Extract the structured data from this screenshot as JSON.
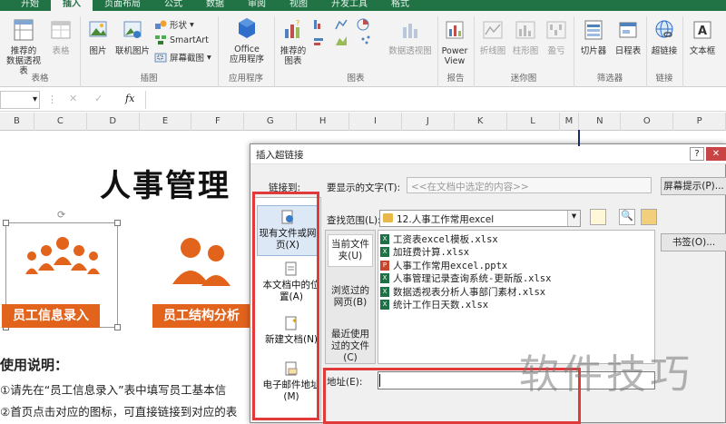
{
  "ribbon": {
    "tabs": [
      "开始",
      "插入",
      "页面布局",
      "公式",
      "数据",
      "审阅",
      "视图",
      "开发工具",
      "格式"
    ],
    "active_tab": "插入",
    "buttons": {
      "recommended_pivot": "推荐的\n数据透视表",
      "table": "表格",
      "picture": "图片",
      "online_picture": "联机图片",
      "shapes": "形状",
      "smartart": "SmartArt",
      "screenshot": "屏幕截图",
      "office_apps": "Office\n应用程序",
      "recommended_charts": "推荐的\n图表",
      "pivot_chart": "数据透视图",
      "power_view": "Power\nView",
      "line": "折线图",
      "column": "柱形图",
      "winloss": "盈亏",
      "slicer": "切片器",
      "timeline": "日程表",
      "hyperlink": "超链接",
      "textbox": "文本框"
    },
    "groups": {
      "tables": "表格",
      "illustrations": "插图",
      "apps": "应用程序",
      "charts": "图表",
      "reports": "报告",
      "sparklines": "迷你图",
      "filters": "筛选器",
      "links": "链接"
    }
  },
  "formula_bar": {
    "fx": "fx",
    "cancel": "✕",
    "enter": "✓"
  },
  "columns": [
    "B",
    "C",
    "D",
    "E",
    "F",
    "G",
    "H",
    "I",
    "J",
    "K",
    "L",
    "M",
    "N",
    "O",
    "P"
  ],
  "sheet": {
    "title": "人事管理",
    "btn_employee_input": "员工信息录入",
    "btn_employee_structure": "员工结构分析",
    "usage_heading": "使用说明：",
    "usage_line1": "①请先在“员工信息录入”表中填写员工基本信",
    "usage_line2": "②首页点击对应的图标，可直接链接到对应的表"
  },
  "dialog": {
    "title": "插入超链接",
    "link_to_label": "链接到:",
    "sidebar": [
      "现有文件或网页(X)",
      "本文档中的位置(A)",
      "新建文档(N)",
      "电子邮件地址(M)"
    ],
    "display_text_label": "要显示的文字(T):",
    "display_text_value": "<<在文档中选定的内容>>",
    "screen_tip_button": "屏幕提示(P)...",
    "look_in_label": "查找范围(L):",
    "look_in_value": "12.人事工作常用excel",
    "bookmark_button": "书签(O)...",
    "nav": [
      "当前文件夹(U)",
      "浏览过的网页(B)",
      "最近使用过的文件(C)"
    ],
    "files": [
      {
        "name": "工资表excel模板.xlsx",
        "type": "xlsx"
      },
      {
        "name": "加班费计算.xlsx",
        "type": "xlsx"
      },
      {
        "name": "人事工作常用excel.pptx",
        "type": "pptx"
      },
      {
        "name": "人事管理记录查询系统-更新版.xlsx",
        "type": "xlsx"
      },
      {
        "name": "数据透视表分析人事部门素材.xlsx",
        "type": "xlsx"
      },
      {
        "name": "统计工作日天数.xlsx",
        "type": "xlsx"
      }
    ],
    "address_label": "地址(E):",
    "address_value": ""
  },
  "watermark": "软件技巧",
  "colors": {
    "ribbon_green": "#217346",
    "orange": "#e2631c",
    "red_highlight": "#e03a3a"
  }
}
